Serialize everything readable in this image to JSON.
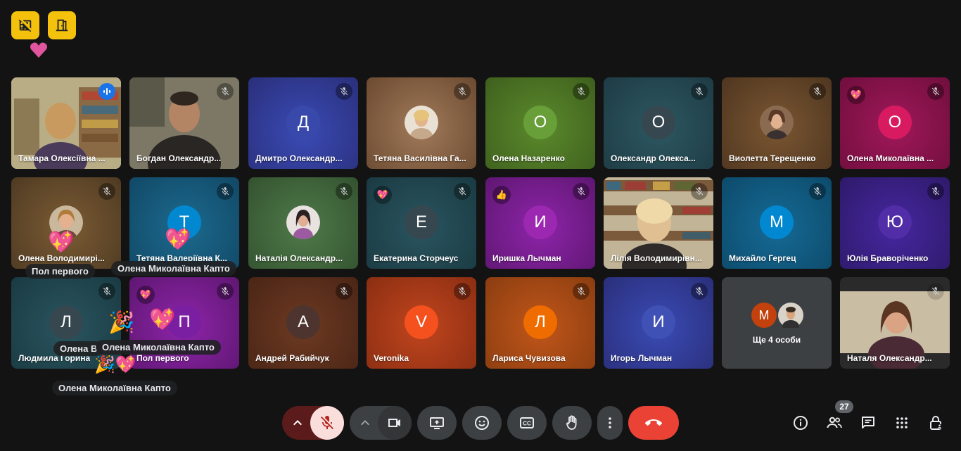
{
  "tiles": [
    {
      "name": "Тамара Олексіївна ..."
    },
    {
      "name": "Богдан Олександр..."
    },
    {
      "name": "Дмитро Олександр...",
      "initial": "Д"
    },
    {
      "name": "Тетяна Василівна Га..."
    },
    {
      "name": "Олена Назаренко",
      "initial": "О"
    },
    {
      "name": "Олександр Олекса...",
      "initial": "О"
    },
    {
      "name": "Виолетта Терещенко"
    },
    {
      "name": "Олена Миколаївна ...",
      "initial": "О",
      "reaction": "💖"
    },
    {
      "name": "Олена Володимирі..."
    },
    {
      "name": "Тетяна Валеріївна К...",
      "initial": "Т"
    },
    {
      "name": "Наталія Олександр..."
    },
    {
      "name": "Екатерина Сторчеус",
      "initial": "Е",
      "reaction": "💖"
    },
    {
      "name": "Иришка Лычман",
      "initial": "И",
      "reaction": "👍"
    },
    {
      "name": "Лілія Володимирівн..."
    },
    {
      "name": "Михайло Гергец",
      "initial": "М"
    },
    {
      "name": "Юлія Браворіченко",
      "initial": "Ю"
    },
    {
      "name": "Людмила Горина",
      "initial": "Л"
    },
    {
      "name": "Пол первого",
      "initial": "П",
      "reaction": "💖"
    },
    {
      "name": "Андрей Рабийчук",
      "initial": "А"
    },
    {
      "name": "Veronika",
      "initial": "V"
    },
    {
      "name": "Лариса Чувизова",
      "initial": "Л"
    },
    {
      "name": "Игорь Лычман",
      "initial": "И"
    },
    {
      "name": "Ще 4 особи",
      "initial": "М"
    },
    {
      "name": "Наталя Олександр..."
    }
  ],
  "reaction_chips": [
    "Пол первого",
    "Олена Миколаївна Капто",
    "Олена В",
    "Олена Миколаївна Капто",
    "Олена Миколаївна Капто"
  ],
  "floating_reactions": [
    "💖",
    "💖",
    "💖",
    "🎉",
    "🎉💖"
  ],
  "participant_count": "27",
  "colors": {
    "accent_yellow": "#f4c20d",
    "end_call_red": "#ea4335",
    "mic_off_bg": "#f9dedc",
    "mic_off_icon": "#b3261e",
    "speaking_blue": "#1a73e8"
  }
}
